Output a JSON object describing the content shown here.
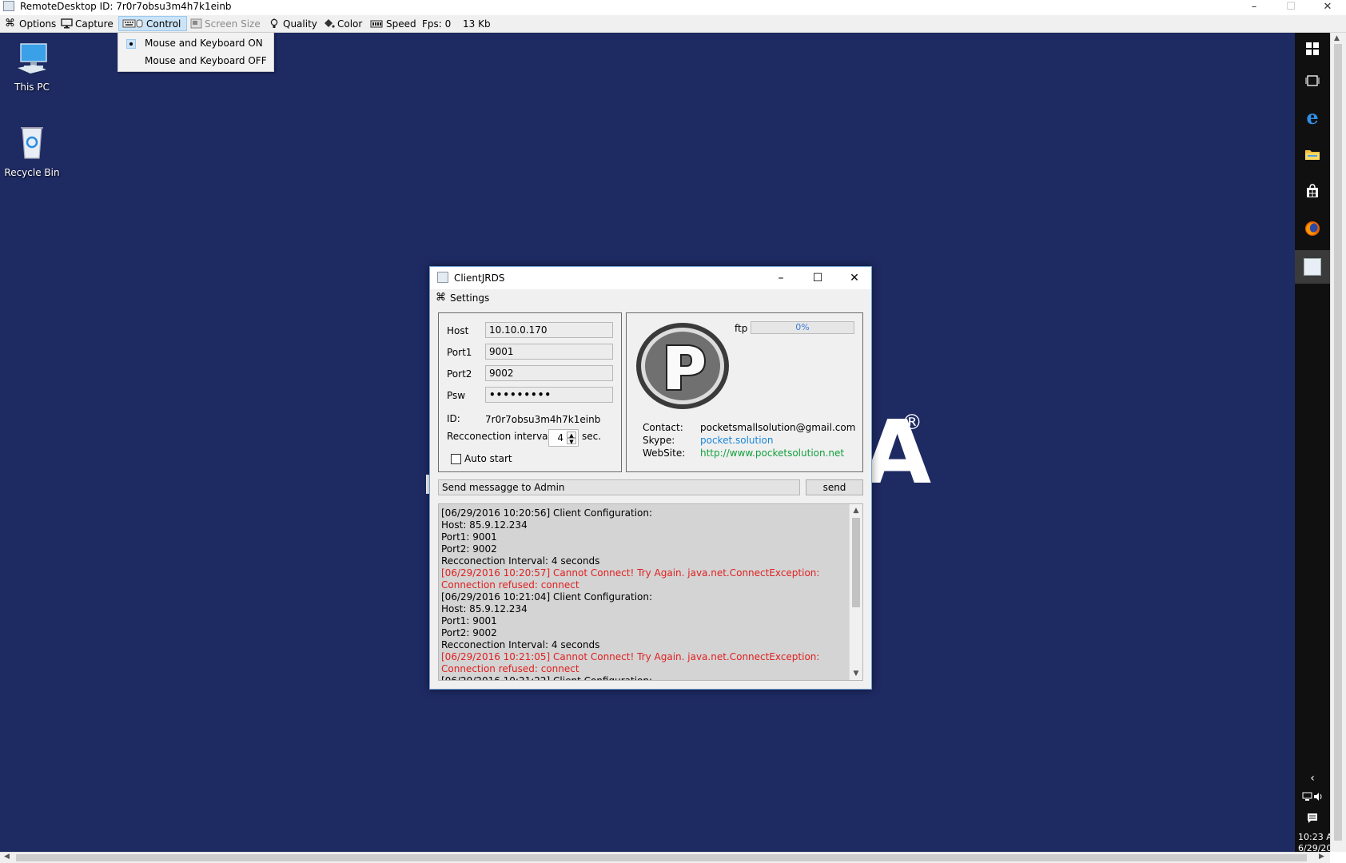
{
  "window": {
    "title": "RemoteDesktop ID: 7r0r7obsu3m4h7k1einb"
  },
  "toolbar": {
    "items": [
      {
        "label": "Options",
        "icon": "options-icon"
      },
      {
        "label": "Capture",
        "icon": "monitor-icon"
      },
      {
        "label": "Control",
        "icon": "keyboard-icon"
      },
      {
        "label": "Screen Size",
        "icon": "screen-size-icon"
      },
      {
        "label": "Quality",
        "icon": "bulb-icon"
      },
      {
        "label": "Color",
        "icon": "paint-bucket-icon"
      },
      {
        "label": "Speed",
        "icon": "speed-icon"
      }
    ],
    "fps": "Fps: 0",
    "size": "13 Kb"
  },
  "control_menu": {
    "items": [
      {
        "label": "Mouse and Keyboard ON",
        "selected": true
      },
      {
        "label": "Mouse and Keyboard OFF",
        "selected": false
      }
    ]
  },
  "desktop": {
    "icons": [
      {
        "label": "This PC"
      },
      {
        "label": "Recycle Bin"
      }
    ],
    "wallpaper_text": "A",
    "wallpaper_reg": "®"
  },
  "taskbar": {
    "time": "10:23 A",
    "date": "6/29/20"
  },
  "client": {
    "title": "ClientJRDS",
    "menu": "Settings",
    "host_label": "Host",
    "host": "10.10.0.170",
    "port1_label": "Port1",
    "port1": "9001",
    "port2_label": "Port2",
    "port2": "9002",
    "psw_label": "Psw",
    "psw": "•••••••••",
    "id_label": "ID:",
    "id": "7r0r7obsu3m4h7k1einb",
    "reconnect_label": "Recconection interval",
    "reconnect_value": "4",
    "reconnect_unit": "sec.",
    "autostart_label": "Auto start",
    "ftp_label": "ftp",
    "ftp_progress": "0%",
    "ftp_progress_value": 0,
    "logo_letter": "P",
    "contact_label": "Contact:",
    "contact": "pocketsmallsolution@gmail.com",
    "skype_label": "Skype:",
    "skype": "pocket.solution",
    "website_label": "WebSite:",
    "website": "http://www.pocketsolution.net",
    "message_placeholder": "Send messagge to Admin",
    "send_label": "send",
    "log": [
      {
        "text": "[06/29/2016 10:20:56] Client Configuration:",
        "error": false
      },
      {
        "text": "Host: 85.9.12.234",
        "error": false
      },
      {
        "text": "Port1: 9001",
        "error": false
      },
      {
        "text": "Port2: 9002",
        "error": false
      },
      {
        "text": "Recconection Interval: 4 seconds",
        "error": false
      },
      {
        "text": "[06/29/2016 10:20:57] Cannot Connect! Try Again. java.net.ConnectException:",
        "error": true
      },
      {
        "text": "Connection refused: connect",
        "error": true
      },
      {
        "text": "[06/29/2016 10:21:04] Client Configuration:",
        "error": false
      },
      {
        "text": "Host: 85.9.12.234",
        "error": false
      },
      {
        "text": "Port1: 9001",
        "error": false
      },
      {
        "text": "Port2: 9002",
        "error": false
      },
      {
        "text": "Recconection Interval: 4 seconds",
        "error": false
      },
      {
        "text": "[06/29/2016 10:21:05] Cannot Connect! Try Again. java.net.ConnectException:",
        "error": true
      },
      {
        "text": "Connection refused: connect",
        "error": true
      },
      {
        "text": "[06/29/2016 10:21:22] Client Configuration:",
        "error": false
      }
    ]
  },
  "colors": {
    "desktop": "#1e2a62",
    "error_text": "#e02020",
    "link_blue": "#1a86d8",
    "link_green": "#12a03c"
  }
}
